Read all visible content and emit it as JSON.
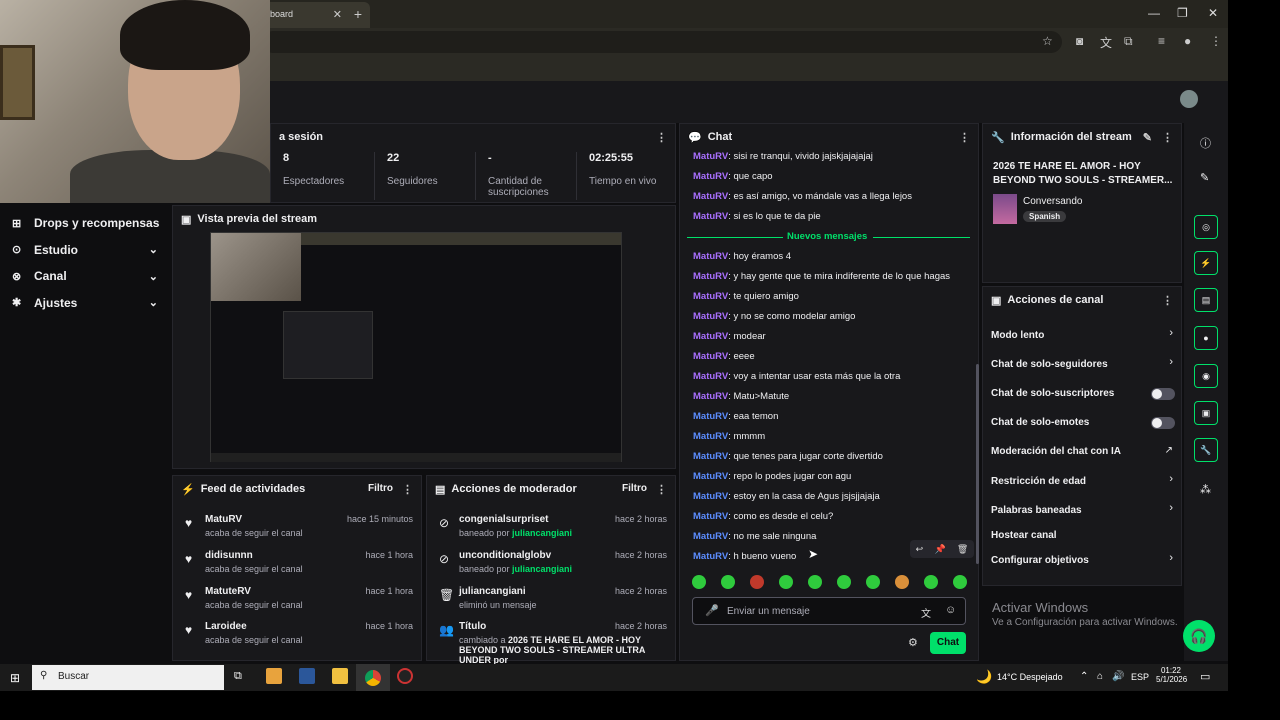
{
  "browser": {
    "tab_title": "board",
    "tab_close": "✕",
    "new_tab": "+"
  },
  "sidebar": {
    "items": [
      {
        "label": "Drops y recompensas",
        "icon": "gift-icon",
        "glyph": "⊞",
        "chevron": ""
      },
      {
        "label": "Estudio",
        "icon": "studio-icon",
        "glyph": "⊙",
        "chevron": "⌄"
      },
      {
        "label": "Canal",
        "icon": "channel-icon",
        "glyph": "⊗",
        "chevron": "⌄"
      },
      {
        "label": "Ajustes",
        "icon": "gear-icon",
        "glyph": "✱",
        "chevron": "⌄"
      }
    ]
  },
  "session": {
    "title": "a sesión",
    "stats": [
      {
        "value": "8",
        "label": "Espectadores"
      },
      {
        "value": "22",
        "label": "Seguidores"
      },
      {
        "value": "-",
        "label": "Cantidad de suscripciones"
      },
      {
        "value": "02:25:55",
        "label": "Tiempo en vivo"
      }
    ]
  },
  "preview": {
    "title": "Vista previa del stream"
  },
  "activity": {
    "title": "Feed de actividades",
    "filter": "Filtro",
    "items": [
      {
        "name": "MatuRV",
        "sub": "acaba de seguir el canal",
        "time": "hace 15 minutos"
      },
      {
        "name": "didisunnn",
        "sub": "acaba de seguir el canal",
        "time": "hace 1 hora"
      },
      {
        "name": "MatuteRV",
        "sub": "acaba de seguir el canal",
        "time": "hace 1 hora"
      },
      {
        "name": "Laroidee",
        "sub": "acaba de seguir el canal",
        "time": "hace 1 hora"
      }
    ]
  },
  "modactions": {
    "title": "Acciones de moderador",
    "filter": "Filtro",
    "items": [
      {
        "name": "congenialsurpriset",
        "sub": "baneado por ",
        "by": "juliancangiani",
        "time": "hace 2 horas",
        "glyph": "⊘"
      },
      {
        "name": "unconditionalglobv",
        "sub": "baneado por ",
        "by": "juliancangiani",
        "time": "hace 2 horas",
        "glyph": "⊘"
      },
      {
        "name": "juliancangiani",
        "sub": "eliminó un mensaje",
        "by": "",
        "time": "hace 2 horas",
        "glyph": "🗑"
      },
      {
        "name": "Título",
        "sub": "cambiado a ",
        "by": "2026 TE HARE EL AMOR - HOY BEYOND",
        "time": "hace 2 horas",
        "glyph": "👥"
      }
    ],
    "title_continuation": "TWO SOULS - STREAMER ULTRA UNDER por"
  },
  "chat": {
    "title": "Chat",
    "new_messages": "Nuevos mensajes",
    "old_messages": [
      {
        "user": "MatuRV",
        "text": ": sisi re tranqui, vivido jajskjajajajaj"
      },
      {
        "user": "MatuRV",
        "text": ": que capo"
      },
      {
        "user": "MatuRV",
        "text": ": es así amigo, vo mándale vas a llega lejos"
      },
      {
        "user": "MatuRV",
        "text": ": si es lo que te da pie"
      }
    ],
    "messages": [
      {
        "user": "MatuRV",
        "text": ": hoy éramos 4",
        "color": "#a970ff"
      },
      {
        "user": "MatuRV",
        "text": ": y hay gente que te mira indiferente de lo que hagas",
        "color": "#a970ff"
      },
      {
        "user": "MatuRV",
        "text": ": te quiero amigo",
        "color": "#a970ff"
      },
      {
        "user": "MatuRV",
        "text": ": y no se como modelar amigo",
        "color": "#a970ff"
      },
      {
        "user": "MatuRV",
        "text": ": modear",
        "color": "#a970ff"
      },
      {
        "user": "MatuRV",
        "text": ": eeee",
        "color": "#a970ff"
      },
      {
        "user": "MatuRV",
        "text": ": voy a intentar usar esta más que la otra",
        "color": "#a970ff"
      },
      {
        "user": "MatuRV",
        "text": ": Matu>Matute",
        "color": "#a970ff"
      },
      {
        "user": "MatuRV",
        "text": ": eaa temon",
        "color": "#5c8dff"
      },
      {
        "user": "MatuRV",
        "text": ": mmmm",
        "color": "#5c8dff"
      },
      {
        "user": "MatuRV",
        "text": ": que tenes para jugar corte divertido",
        "color": "#5c8dff"
      },
      {
        "user": "MatuRV",
        "text": ": repo lo podes jugar con agu",
        "color": "#5c8dff"
      },
      {
        "user": "MatuRV",
        "text": ": estoy en la casa de Agus jsjsjjajaja",
        "color": "#5c8dff"
      },
      {
        "user": "MatuRV",
        "text": ": como es desde el celu?",
        "color": "#5c8dff"
      },
      {
        "user": "MatuRV",
        "text": ": no me sale ninguna",
        "color": "#5c8dff"
      },
      {
        "user": "MatuRV",
        "text": ": h bueno vueno",
        "color": "#5c8dff"
      }
    ],
    "input_placeholder": "Enviar un mensaje",
    "send_label": "Chat"
  },
  "stream_info": {
    "title": "Información del stream",
    "stream_title": "2026 TE HARE EL AMOR - HOY BEYOND TWO SOULS - STREAMER...",
    "category": "Conversando",
    "tag": "Spanish"
  },
  "channel_actions": {
    "title": "Acciones de canal",
    "items": [
      {
        "label": "Modo lento",
        "control": "chevron"
      },
      {
        "label": "Chat de solo-seguidores",
        "control": "chevron"
      },
      {
        "label": "Chat de solo-suscriptores",
        "control": "toggle"
      },
      {
        "label": "Chat de solo-emotes",
        "control": "toggle"
      },
      {
        "label": "Moderación del chat con IA",
        "control": "external"
      },
      {
        "label": "Restricción de edad",
        "control": "chevron"
      },
      {
        "label": "Palabras baneadas",
        "control": "chevron"
      },
      {
        "label": "Hostear canal",
        "control": "none"
      },
      {
        "label": "Configurar objetivos",
        "control": "chevron"
      }
    ]
  },
  "windows_watermark": {
    "line1": "Activar Windows",
    "line2": "Ve a Configuración para activar Windows."
  },
  "taskbar": {
    "search": "Buscar",
    "weather": "14°C  Despejado",
    "lang": "ESP",
    "time": "01:22",
    "date": "5/1/2026"
  },
  "colors": {
    "accent": "#00e06a",
    "bg": "#0e0e10",
    "panel": "#18181b"
  }
}
